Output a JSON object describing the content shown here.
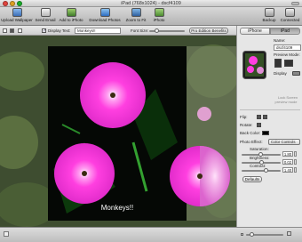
{
  "window": {
    "title": "iPad (768x1024) - dscf4109"
  },
  "toolbar": {
    "upload_wallpaper": "Upload Wallpaper",
    "send_email": "Send Email",
    "add_to_iphoto": "Add to iPhoto",
    "download_photos": "Download Photos",
    "zoom_to_fit": "Zoom to Fit",
    "iphoto": "iPhoto",
    "backup": "Backup",
    "connected": "Connected"
  },
  "editbar": {
    "display_text_label": "Display Text:",
    "display_text_value": "Monkeys!!",
    "display_text_checked": true,
    "font_size_label": "Font Size:",
    "pro_button": "Pro Edition Benefits"
  },
  "photo": {
    "caption": "Monkeys!!"
  },
  "panel": {
    "tab_iphone": "iPhone",
    "tab_ipad": "iPad",
    "name_label": "Name:",
    "name_value": "dscf4109",
    "preview_mode_label": "Preview Mode:",
    "display_label": "Display",
    "lock_screen_line1": "Lock Screen",
    "lock_screen_line2": "preview mode",
    "flip_label": "Flip:",
    "rotate_label": "Rotate:",
    "back_color_label": "Back Color:",
    "photo_effect_label": "Photo Effect:",
    "photo_effect_value": "Color Controls",
    "saturation_label": "Saturation:",
    "saturation_value": "1.80",
    "brightness_label": "Brightness:",
    "brightness_value": "0.02",
    "contrast_label": "Contrast:",
    "contrast_value": "1.40",
    "defaults_button": "Defaults"
  },
  "colors": {
    "accent": "#5a8fd8",
    "flower": "#ff3fe0"
  }
}
